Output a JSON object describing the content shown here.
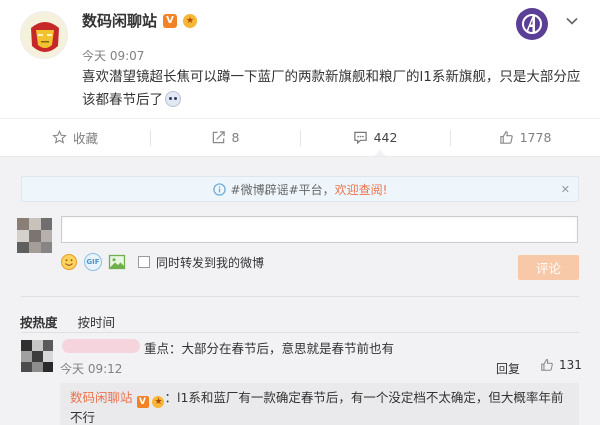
{
  "post": {
    "author": "数码闲聊站",
    "time": "今天 09:07",
    "text": "喜欢潜望镜超长焦可以蹲一下蓝厂的两款新旗舰和粮厂的l1系新旗舰，只是大部分应该都春节后了",
    "verified_badge": "V"
  },
  "actions": {
    "favorite": "收藏",
    "repost_count": "8",
    "comment_count": "442",
    "like_count": "1778"
  },
  "comment_box": {
    "notice_prefix": "#微博辟谣#平台，",
    "notice_link": "欢迎查阅!",
    "repost_label": "同时转发到我的微博",
    "submit_label": "评论",
    "gif_label": "GIF"
  },
  "sort": {
    "hot": "按热度",
    "time": "按时间"
  },
  "comments": [
    {
      "text": "重点：大部分在春节后，意思就是春节前也有",
      "time": "今天 09:12",
      "reply_label": "回复",
      "likes": "131",
      "reply": {
        "author": "数码闲聊站",
        "text": "：l1系和蓝厂有一款确定春节后，有一个没定档不太确定，但大概率年前不行"
      }
    }
  ],
  "colors": {
    "accent": "#eb7350",
    "submit_disabled": "#f8c9a8",
    "comment_bg": "#f2f2f5",
    "brand_logo": "#5b3f96"
  }
}
